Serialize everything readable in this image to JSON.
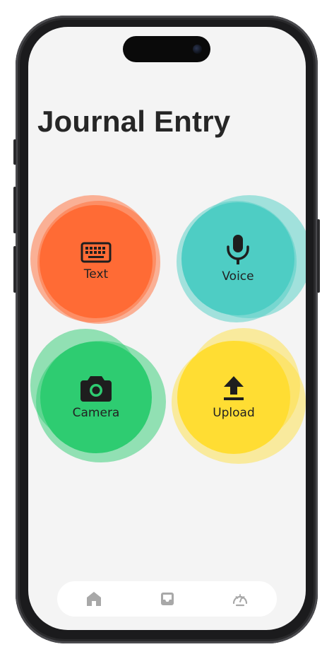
{
  "page": {
    "title": "Journal Entry"
  },
  "entry_options": [
    {
      "label": "Text",
      "icon": "keyboard-icon",
      "color": "#FF6B35"
    },
    {
      "label": "Voice",
      "icon": "microphone-icon",
      "color": "#4ECDC4"
    },
    {
      "label": "Camera",
      "icon": "camera-icon",
      "color": "#2ECC71"
    },
    {
      "label": "Upload",
      "icon": "upload-icon",
      "color": "#FFDD33"
    }
  ],
  "bottom_nav": [
    {
      "icon": "home-icon"
    },
    {
      "icon": "inbox-icon"
    },
    {
      "icon": "dashboard-icon"
    }
  ],
  "colors": {
    "background": "#F4F4F4",
    "title": "#262626",
    "nav_icon": "#A8A8A8"
  }
}
